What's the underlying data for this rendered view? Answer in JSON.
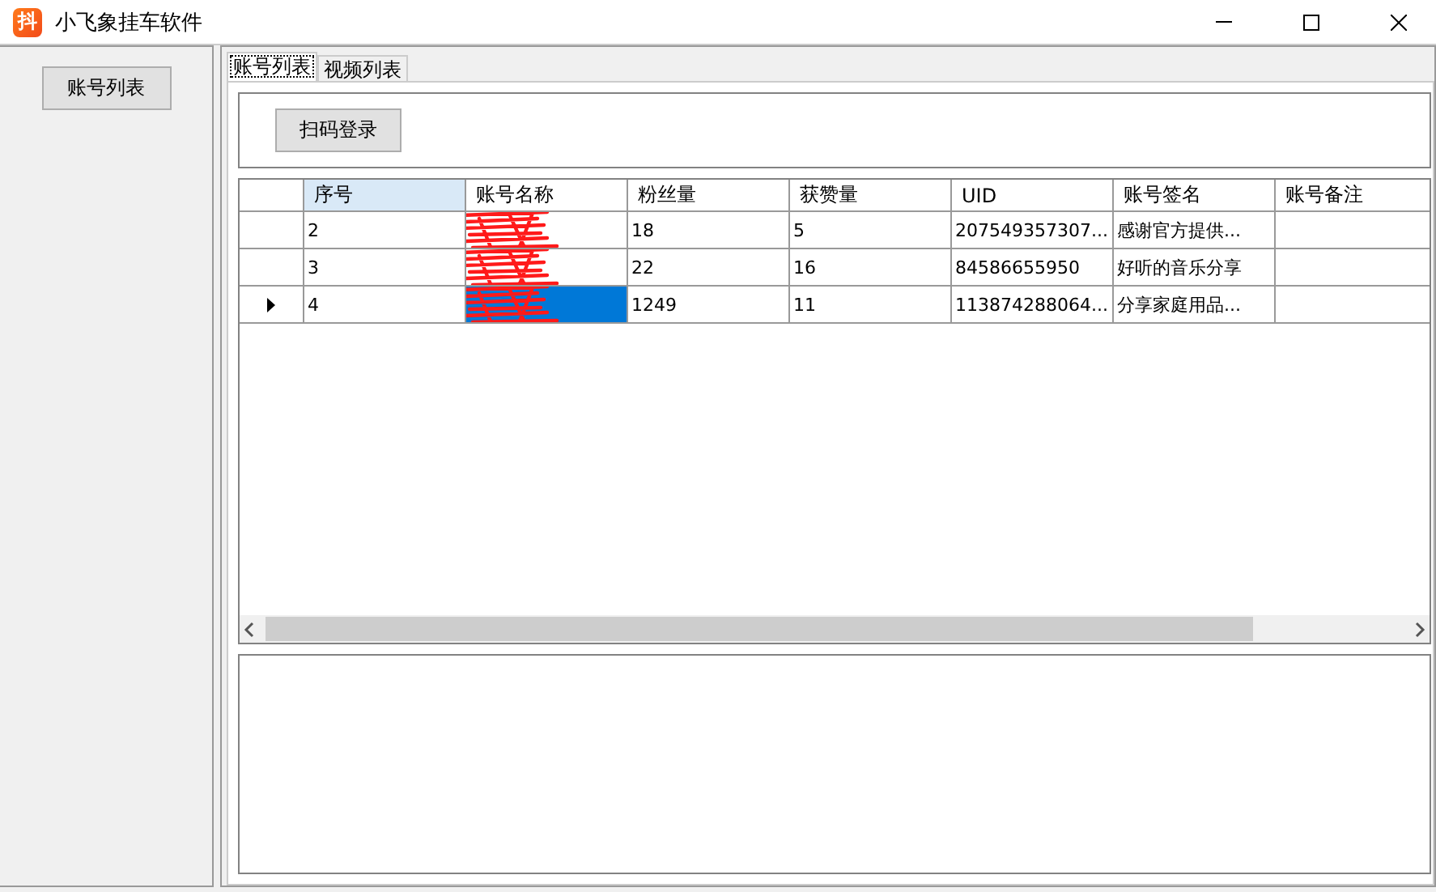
{
  "window": {
    "app_icon_text": "抖",
    "title": "小飞象挂车软件"
  },
  "sidebar": {
    "buttons": [
      {
        "label": "账号列表"
      }
    ]
  },
  "tabs": [
    {
      "label": "账号列表",
      "selected": true
    },
    {
      "label": "视频列表",
      "selected": false
    }
  ],
  "toolbar": {
    "buttons": [
      {
        "label": "扫码登录"
      }
    ]
  },
  "table": {
    "columns": [
      {
        "label": "序号",
        "selected": true
      },
      {
        "label": "账号名称",
        "selected": false
      },
      {
        "label": "粉丝量",
        "selected": false
      },
      {
        "label": "获赞量",
        "selected": false
      },
      {
        "label": "UID",
        "selected": false
      },
      {
        "label": "账号签名",
        "selected": false
      },
      {
        "label": "账号备注",
        "selected": false
      }
    ],
    "rows": [
      {
        "current": false,
        "cells": [
          {
            "text": "2",
            "selected": false
          },
          {
            "redacted": true,
            "selected": false
          },
          {
            "text": "18",
            "selected": false
          },
          {
            "text": "5",
            "selected": false
          },
          {
            "text": "207549357307...",
            "selected": false
          },
          {
            "text": "感谢官方提供...",
            "selected": false
          },
          {
            "selected": false
          }
        ]
      },
      {
        "current": false,
        "cells": [
          {
            "text": "3",
            "selected": false
          },
          {
            "redacted": true,
            "selected": false
          },
          {
            "text": "22",
            "selected": false
          },
          {
            "text": "16",
            "selected": false
          },
          {
            "text": "84586655950",
            "selected": false
          },
          {
            "text": "好听的音乐分享",
            "selected": false
          },
          {
            "selected": false
          }
        ]
      },
      {
        "current": true,
        "cells": [
          {
            "text": "4",
            "selected": false
          },
          {
            "redacted": true,
            "selected": true
          },
          {
            "text": "1249",
            "selected": false
          },
          {
            "text": "11",
            "selected": false
          },
          {
            "text": "113874288064...",
            "selected": false
          },
          {
            "text": "分享家庭用品...",
            "selected": false
          },
          {
            "selected": false
          }
        ]
      }
    ]
  }
}
